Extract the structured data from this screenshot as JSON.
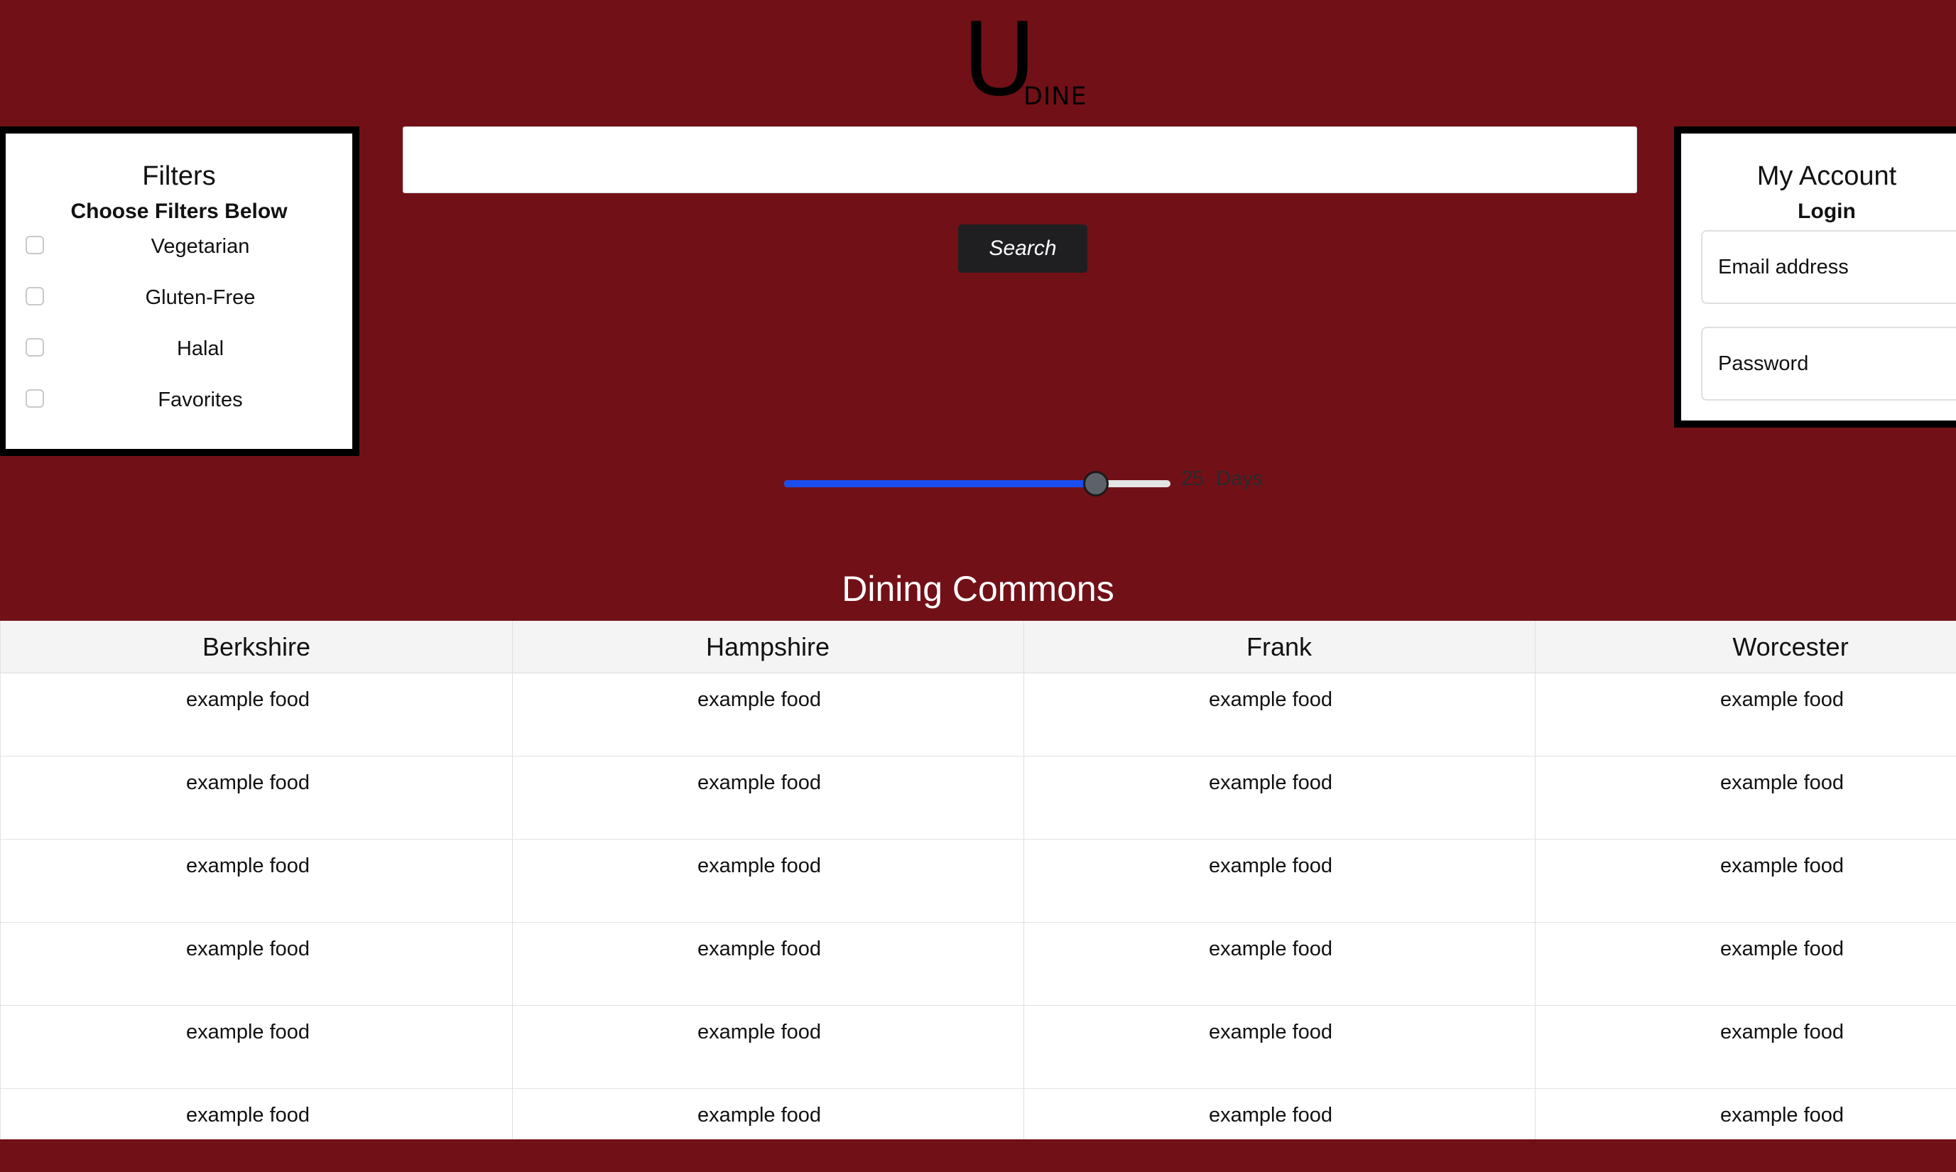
{
  "logo": {
    "letter": "U",
    "word": "DINE"
  },
  "filters": {
    "title": "Filters",
    "subtitle": "Choose Filters Below",
    "items": [
      {
        "label": "Vegetarian",
        "checked": false
      },
      {
        "label": "Gluten-Free",
        "checked": false
      },
      {
        "label": "Halal",
        "checked": false
      },
      {
        "label": "Favorites",
        "checked": false
      }
    ]
  },
  "search": {
    "value": "",
    "placeholder": "",
    "button_label": "Search"
  },
  "account": {
    "title": "My Account",
    "subtitle": "Login",
    "email_label": "Email address",
    "password_label": "Password"
  },
  "slider": {
    "value": 25,
    "min": 0,
    "max": 31,
    "unit": "Days"
  },
  "dining": {
    "title": "Dining Commons",
    "columns": [
      "Berkshire",
      "Hampshire",
      "Frank",
      "Worcester"
    ],
    "rows": [
      [
        "example food",
        "example food",
        "example food",
        "example food"
      ],
      [
        "example food",
        "example food",
        "example food",
        "example food"
      ],
      [
        "example food",
        "example food",
        "example food",
        "example food"
      ],
      [
        "example food",
        "example food",
        "example food",
        "example food"
      ],
      [
        "example food",
        "example food",
        "example food",
        "example food"
      ],
      [
        "example food",
        "example food",
        "example food",
        "example food"
      ]
    ]
  },
  "colors": {
    "background": "#721018",
    "panel": "#ffffff",
    "panel_border": "#000000",
    "button": "#1f1f21",
    "slider_fill": "#1a4df0"
  }
}
